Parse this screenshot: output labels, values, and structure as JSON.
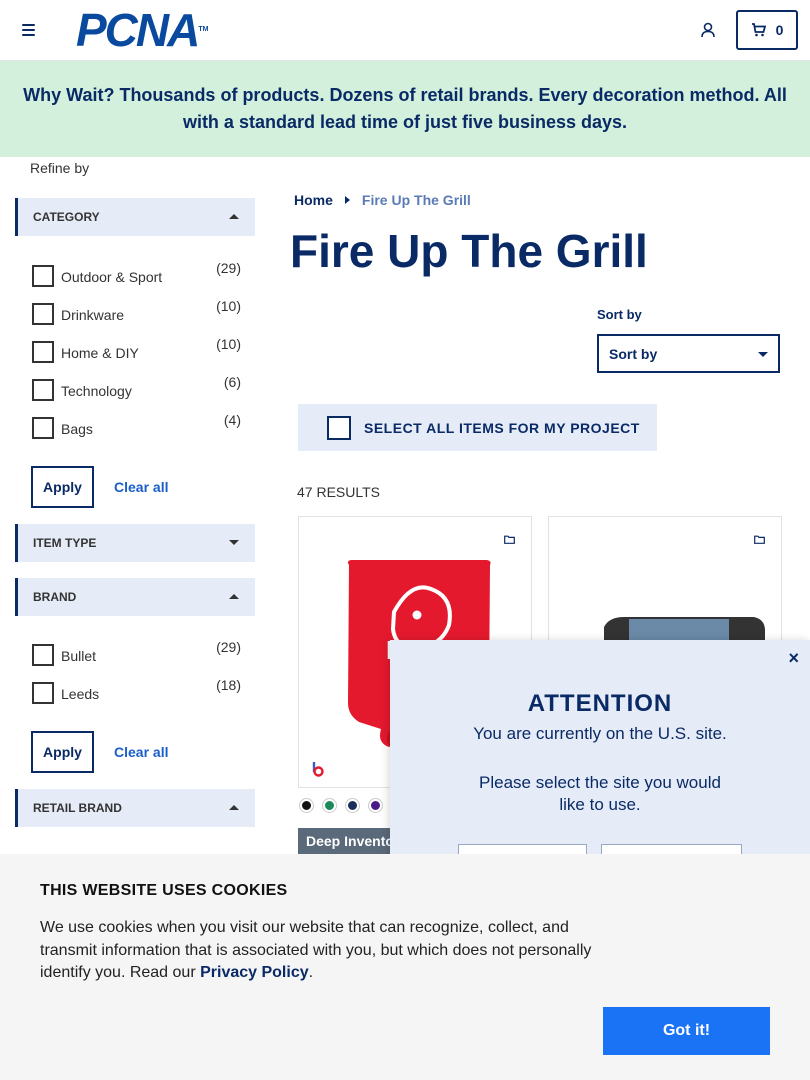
{
  "header": {
    "logo_text": "PCNA",
    "logo_tm": "TM",
    "cart_count": "0"
  },
  "banner": {
    "text": "Why Wait? Thousands of products. Dozens of retail brands. Every decoration method. All with a standard lead time of just five business days."
  },
  "sidebar": {
    "refine_label": "Refine by",
    "category": {
      "title": "CATEGORY",
      "items": [
        {
          "label": "Outdoor & Sport",
          "count": "(29)"
        },
        {
          "label": "Drinkware",
          "count": "(10)"
        },
        {
          "label": "Home & DIY",
          "count": "(10)"
        },
        {
          "label": "Technology",
          "count": "(6)"
        },
        {
          "label": "Bags",
          "count": "(4)"
        }
      ]
    },
    "item_type": {
      "title": "ITEM TYPE"
    },
    "brand": {
      "title": "BRAND",
      "items": [
        {
          "label": "Bullet",
          "count": "(29)"
        },
        {
          "label": "Leeds",
          "count": "(18)"
        }
      ]
    },
    "retail_brand": {
      "title": "RETAIL BRAND"
    },
    "apply_label": "Apply",
    "clear_label": "Clear all"
  },
  "main": {
    "breadcrumb": {
      "home": "Home",
      "current": "Fire Up The Grill"
    },
    "title": "Fire Up The Grill",
    "sort_label": "Sort by",
    "sort_value": "Sort by",
    "select_all": "SELECT ALL ITEMS FOR MY PROJECT",
    "results": "47 RESULTS",
    "badge": "Deep Invento",
    "swatch_colors": [
      "#111111",
      "#1a8a5a",
      "#1b2f5a",
      "#4a1a8a"
    ]
  },
  "attention": {
    "title": "ATTENTION",
    "line1": "You are currently on the U.S. site.",
    "line2": "Please select the site you would",
    "line3": "like to use.",
    "close": "×"
  },
  "cookie": {
    "title": "THIS WEBSITE USES COOKIES",
    "text": "We use cookies when you visit our website that can recognize, collect, and transmit information that is associated with you, but which does not personally identify you. Read our ",
    "link": "Privacy Policy",
    "period": ".",
    "button": "Got it!"
  },
  "colors": {
    "navy": "#0a2a66",
    "banner_bg": "#d2f0dc",
    "facet_bg": "#e6ecf7",
    "accent_blue": "#1a73f5",
    "koozie_red": "#e5192e"
  }
}
